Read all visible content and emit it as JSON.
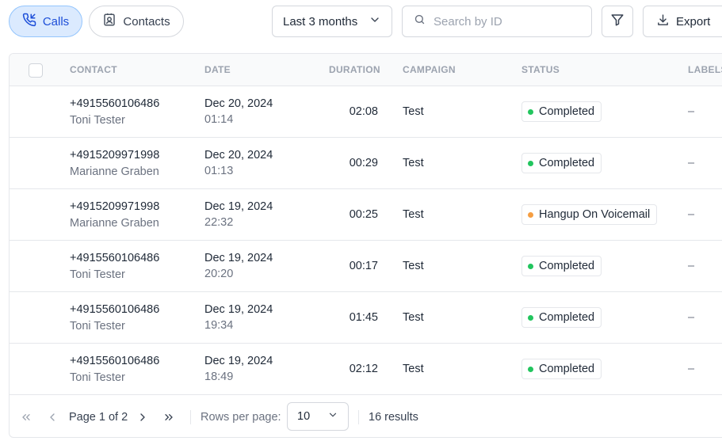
{
  "toolbar": {
    "calls_label": "Calls",
    "contacts_label": "Contacts",
    "date_range": "Last 3 months",
    "search_placeholder": "Search by ID",
    "export_label": "Export"
  },
  "table": {
    "headers": {
      "contact": "CONTACT",
      "date": "DATE",
      "duration": "DURATION",
      "campaign": "CAMPAIGN",
      "status": "STATUS",
      "labels": "LABELS"
    },
    "rows": [
      {
        "phone": "+4915560106486",
        "name": "Toni Tester",
        "date": "Dec 20, 2024",
        "time": "01:14",
        "duration": "02:08",
        "campaign": "Test",
        "status": "Completed",
        "status_color": "#22c55e",
        "labels": "–"
      },
      {
        "phone": "+4915209971998",
        "name": "Marianne Graben",
        "date": "Dec 20, 2024",
        "time": "01:13",
        "duration": "00:29",
        "campaign": "Test",
        "status": "Completed",
        "status_color": "#22c55e",
        "labels": "–"
      },
      {
        "phone": "+4915209971998",
        "name": "Marianne Graben",
        "date": "Dec 19, 2024",
        "time": "22:32",
        "duration": "00:25",
        "campaign": "Test",
        "status": "Hangup On Voicemail",
        "status_color": "#f59e42",
        "labels": "–"
      },
      {
        "phone": "+4915560106486",
        "name": "Toni Tester",
        "date": "Dec 19, 2024",
        "time": "20:20",
        "duration": "00:17",
        "campaign": "Test",
        "status": "Completed",
        "status_color": "#22c55e",
        "labels": "–"
      },
      {
        "phone": "+4915560106486",
        "name": "Toni Tester",
        "date": "Dec 19, 2024",
        "time": "19:34",
        "duration": "01:45",
        "campaign": "Test",
        "status": "Completed",
        "status_color": "#22c55e",
        "labels": "–"
      },
      {
        "phone": "+4915560106486",
        "name": "Toni Tester",
        "date": "Dec 19, 2024",
        "time": "18:49",
        "duration": "02:12",
        "campaign": "Test",
        "status": "Completed",
        "status_color": "#22c55e",
        "labels": "–"
      }
    ]
  },
  "pagination": {
    "page_text": "Page 1 of 2",
    "rows_per_page_label": "Rows per page:",
    "rows_per_page": "10",
    "results": "16 results"
  },
  "icons": {
    "calls": "phone-call-icon",
    "contacts": "contact-card-icon",
    "dropdown": "chevron-down-icon",
    "search": "search-icon",
    "filter": "filter-icon",
    "export": "download-icon",
    "first": "chevrons-left-icon",
    "prev": "chevron-left-icon",
    "next": "chevron-right-icon",
    "last": "chevrons-right-icon"
  },
  "colors": {
    "accent": "#1d4ed8",
    "accent_bg": "#dbeafe",
    "completed": "#22c55e",
    "voicemail": "#f59e42"
  }
}
